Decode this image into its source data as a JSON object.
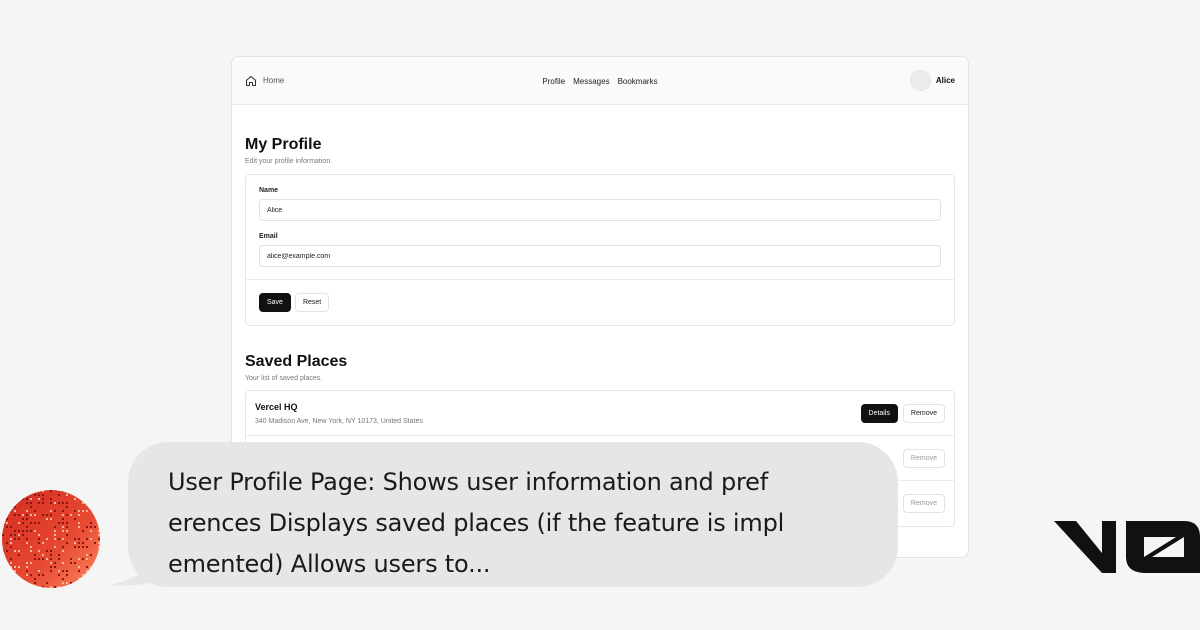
{
  "nav": {
    "home_label": "Home",
    "links": [
      "Profile",
      "Messages",
      "Bookmarks"
    ],
    "user_name": "Alice"
  },
  "profile": {
    "title": "My Profile",
    "subtitle": "Edit your profile information.",
    "name_label": "Name",
    "name_value": "Alice",
    "email_label": "Email",
    "email_value": "alice@example.com",
    "save_label": "Save",
    "reset_label": "Reset"
  },
  "places": {
    "title": "Saved Places",
    "subtitle": "Your list of saved places.",
    "items": [
      {
        "name": "Vercel HQ",
        "address": "340 Madison Ave, New York, NY 10173, United States",
        "details_label": "Details",
        "remove_label": "Remove"
      },
      {
        "name": "",
        "address": "",
        "details_label": "",
        "remove_label": "Remove"
      },
      {
        "name": "",
        "address": "",
        "details_label": "",
        "remove_label": "Remove"
      }
    ]
  },
  "bubble": {
    "lines": [
      "User Profile Page: Shows user information and pref",
      "erences Displays saved places (if the feature is impl",
      "emented) Allows users to..."
    ]
  },
  "icons": {
    "home": "home-icon",
    "speaker": "pixel-avatar-icon",
    "brand": "v0-logo"
  },
  "colors": {
    "page_bg": "#f5f5f5",
    "bubble_bg": "#e6e6e8",
    "primary_button": "#111111",
    "avatar_red": "#e0372a",
    "avatar_orange": "#ff7f5a"
  }
}
